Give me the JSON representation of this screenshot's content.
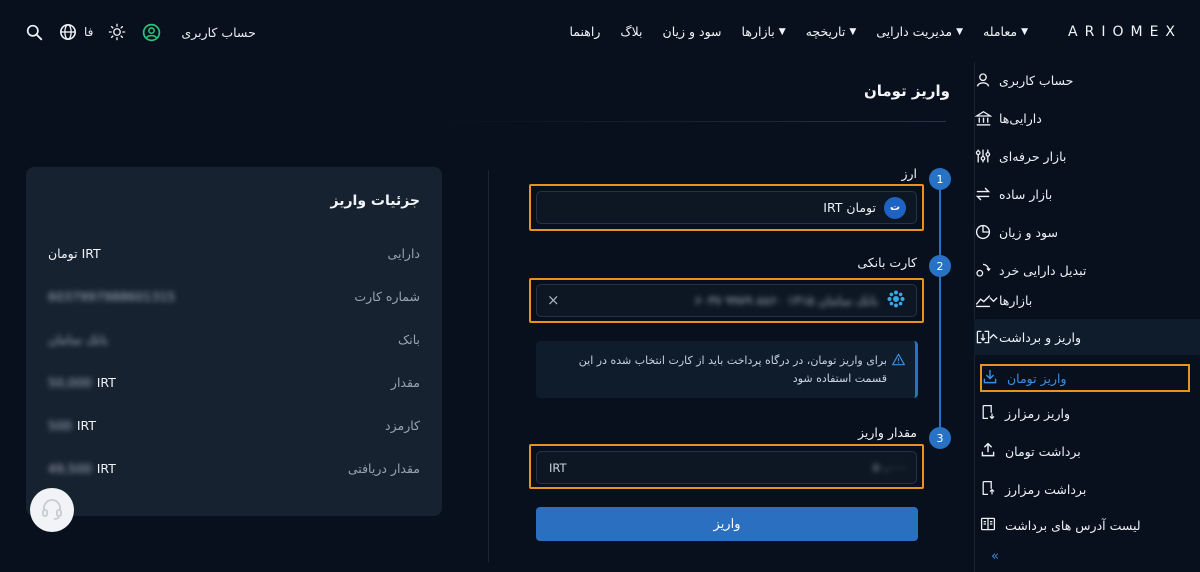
{
  "brand": {
    "logo": "ARIOMEX"
  },
  "nav": {
    "items": [
      {
        "label": "معامله",
        "dropdown": true
      },
      {
        "label": "مدیریت دارایی",
        "dropdown": true
      },
      {
        "label": "تاریخچه",
        "dropdown": true
      },
      {
        "label": "بازارها",
        "dropdown": true
      },
      {
        "label": "سود و زیان",
        "dropdown": false
      },
      {
        "label": "بلاگ",
        "dropdown": false
      },
      {
        "label": "راهنما",
        "dropdown": false
      }
    ],
    "account_label": "حساب کاربری",
    "language": "فا"
  },
  "sidebar": {
    "items": [
      {
        "label": "حساب کاربری",
        "icon": "user-icon"
      },
      {
        "label": "دارایی‌ها",
        "icon": "bank-icon"
      },
      {
        "label": "بازار حرفه‌ای",
        "icon": "sliders-icon"
      },
      {
        "label": "بازار ساده",
        "icon": "swap-icon"
      },
      {
        "label": "سود و زیان",
        "icon": "pie-chart-icon"
      },
      {
        "label": "تبدیل دارایی خرد",
        "icon": "convert-icon"
      },
      {
        "label": "بازارها",
        "icon": "chart-line-icon"
      },
      {
        "label": "واریز و برداشت",
        "icon": "deposit-withdraw-icon"
      }
    ],
    "sub_items": [
      {
        "label": "واریز تومان",
        "icon": "download-icon"
      },
      {
        "label": "واریز رمزارز",
        "icon": "crypto-deposit-icon"
      },
      {
        "label": "برداشت تومان",
        "icon": "upload-icon"
      },
      {
        "label": "برداشت رمزارز",
        "icon": "crypto-withdraw-icon"
      },
      {
        "label": "لیست آدرس های برداشت",
        "icon": "address-book-icon"
      }
    ]
  },
  "page": {
    "title": "واریز تومان"
  },
  "form": {
    "steps": [
      "1",
      "2",
      "3"
    ],
    "currency_label": "ارز",
    "currency_value": "IRT تومان",
    "bank_card_label": "کارت بانکی",
    "bank_card_value": "۶۰۳۷ ۹۹۷۹ ۸۸۶۰ ۱۳۱۵ بانک سامان",
    "info_text": "برای واریز تومان، در درگاه پرداخت باید از کارت انتخاب شده در این قسمت استفاده شود",
    "amount_label": "مقدار واریز",
    "amount_value": "۵۰,۰۰۰",
    "amount_unit": "IRT",
    "submit_label": "واریز"
  },
  "details": {
    "title": "جزئیات واریز",
    "rows": [
      {
        "label": "دارایی",
        "value": "IRT تومان",
        "unit": ""
      },
      {
        "label": "شماره کارت",
        "value": "6037997988601315",
        "unit": ""
      },
      {
        "label": "بانک",
        "value": "بانک سامان",
        "unit": ""
      },
      {
        "label": "مقدار",
        "value": "50,000",
        "unit": "IRT"
      },
      {
        "label": "کارمزد",
        "value": "500",
        "unit": "IRT"
      },
      {
        "label": "مقدار دریافتی",
        "value": "49,500",
        "unit": "IRT"
      }
    ]
  },
  "colors": {
    "accent": "#2772c4",
    "highlight": "#e8931d",
    "background": "#07101c",
    "card": "#172230"
  }
}
